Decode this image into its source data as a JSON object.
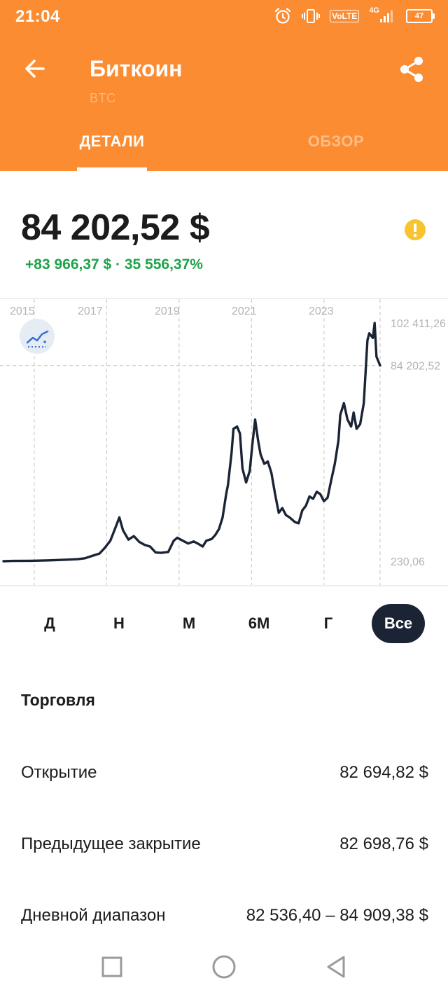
{
  "status_bar": {
    "time": "21:04",
    "icons": [
      "alarm-icon",
      "vibrate-icon",
      "volte-icon",
      "signal-icon",
      "battery-icon"
    ],
    "volte": "VoLTE",
    "network": "4G",
    "battery": "47"
  },
  "header": {
    "title": "Биткоин",
    "subtitle": "BTC",
    "tabs": [
      {
        "label": "ДЕТАЛИ",
        "active": true
      },
      {
        "label": "ОБЗОР",
        "active": false
      }
    ]
  },
  "quote": {
    "price": "84 202,52 $",
    "change": "+83 966,37 $ · 35 556,37%"
  },
  "chart_data": {
    "type": "line",
    "x_tick_labels": [
      "2015",
      "2017",
      "2019",
      "2021",
      "2023"
    ],
    "y_labels": [
      "102 411,26",
      "84 202,52",
      "230,06"
    ],
    "y_max": 102411.26,
    "y_current": 84202.52,
    "y_min": 230.06,
    "grid": true,
    "line_color": "#1b2435",
    "series": [
      {
        "x": [
          2014.75,
          2015.0,
          2015.5,
          2016.0,
          2016.5,
          2016.8,
          2017.0,
          2017.2,
          2017.4,
          2017.55,
          2017.7,
          2017.85,
          2017.95,
          2018.05,
          2018.2,
          2018.35,
          2018.5,
          2018.65,
          2018.8,
          2018.95,
          2019.1,
          2019.3,
          2019.45,
          2019.55,
          2019.7,
          2019.85,
          2020.0,
          2020.15,
          2020.25,
          2020.35,
          2020.5,
          2020.6,
          2020.7,
          2020.8,
          2020.9,
          2020.95,
          2021.05,
          2021.1,
          2021.2,
          2021.28,
          2021.35,
          2021.45,
          2021.55,
          2021.62,
          2021.7,
          2021.78,
          2021.85,
          2021.95,
          2022.05,
          2022.15,
          2022.25,
          2022.35,
          2022.45,
          2022.55,
          2022.65,
          2022.8,
          2022.9,
          2023.0,
          2023.1,
          2023.2,
          2023.3,
          2023.4,
          2023.5,
          2023.6,
          2023.7,
          2023.8,
          2023.9,
          2024.0,
          2024.05,
          2024.15,
          2024.25,
          2024.35,
          2024.42,
          2024.5,
          2024.6,
          2024.7,
          2024.8,
          2024.85,
          2024.95,
          2025.0,
          2025.05,
          2025.15
        ],
        "values": [
          230,
          350,
          420,
          600,
          900,
          1100,
          1500,
          2500,
          3500,
          6000,
          9000,
          15000,
          19000,
          13500,
          9500,
          11000,
          8500,
          7200,
          6500,
          4000,
          3800,
          4200,
          9000,
          10300,
          9000,
          7800,
          8700,
          7500,
          6500,
          9000,
          9800,
          11500,
          14000,
          19000,
          29000,
          33000,
          47000,
          57000,
          58000,
          55000,
          40000,
          34000,
          39000,
          50000,
          61000,
          52000,
          46000,
          42000,
          43000,
          38000,
          29000,
          21000,
          23000,
          20000,
          19000,
          17000,
          16500,
          22000,
          24000,
          28000,
          27000,
          30000,
          29000,
          26000,
          27500,
          35000,
          42000,
          52000,
          63000,
          68000,
          61000,
          58000,
          64000,
          57000,
          59000,
          68000,
          95000,
          98000,
          96000,
          102411,
          88000,
          84202
        ]
      }
    ]
  },
  "range_buttons": [
    {
      "label": "Д",
      "active": false
    },
    {
      "label": "Н",
      "active": false
    },
    {
      "label": "М",
      "active": false
    },
    {
      "label": "6М",
      "active": false
    },
    {
      "label": "Г",
      "active": false
    },
    {
      "label": "Все",
      "active": true
    }
  ],
  "trading": {
    "title": "Торговля",
    "rows": [
      {
        "label": "Открытие",
        "value": "82 694,82 $"
      },
      {
        "label": "Предыдущее закрытие",
        "value": "82 698,76 $"
      },
      {
        "label": "Дневной диапазон",
        "value": "82 536,40 – 84 909,38 $"
      }
    ]
  },
  "nav": [
    "recents-square-icon",
    "home-circle-icon",
    "back-triangle-icon"
  ]
}
